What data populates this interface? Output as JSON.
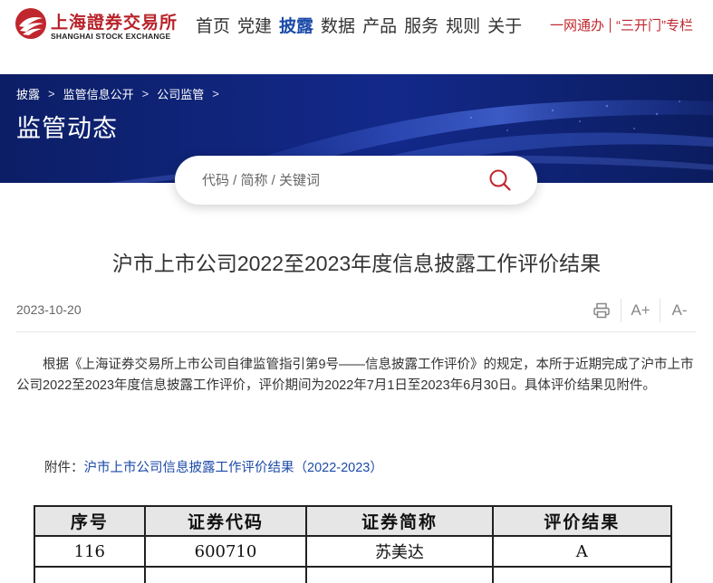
{
  "header": {
    "logo_cn": "上海證券交易所",
    "logo_en": "SHANGHAI STOCK EXCHANGE",
    "nav": [
      {
        "label": "首页",
        "active": false
      },
      {
        "label": "党建",
        "active": false
      },
      {
        "label": "披露",
        "active": true
      },
      {
        "label": "数据",
        "active": false
      },
      {
        "label": "产品",
        "active": false
      },
      {
        "label": "服务",
        "active": false
      },
      {
        "label": "规则",
        "active": false
      },
      {
        "label": "关于",
        "active": false
      }
    ],
    "link_1": "一网通办",
    "link_2": "“三开门”专栏",
    "accent_color": "#c0262d",
    "nav_active_color": "#1c4aa8"
  },
  "banner": {
    "breadcrumb": [
      "披露",
      "监管信息公开",
      "公司监管"
    ],
    "title": "监管动态",
    "bg_color": "#0e2168"
  },
  "search": {
    "placeholder": "代码 / 简称 / 关键词",
    "icon": "search-icon"
  },
  "article": {
    "title": "沪市上市公司2022至2023年度信息披露工作评价结果",
    "date": "2023-10-20",
    "tools": [
      "print-icon",
      "font-increase",
      "font-decrease"
    ],
    "font_increase_label": "A+",
    "font_decrease_label": "A-",
    "paragraph": "根据《上海证券交易所上市公司自律监管指引第9号——信息披露工作评价》的规定，本所于近期完成了沪市上市公司2022至2023年度信息披露工作评价，评价期间为2022年7月1日至2023年6月30日。具体评价结果见附件。",
    "attachment_prefix": "附件：",
    "attachment_link": "沪市上市公司信息披露工作评价结果（2022-2023）"
  },
  "table": {
    "headers": [
      "序号",
      "证券代码",
      "证券简称",
      "评价结果"
    ],
    "rows": [
      [
        "116",
        "600710",
        "苏美达",
        "A"
      ]
    ]
  }
}
